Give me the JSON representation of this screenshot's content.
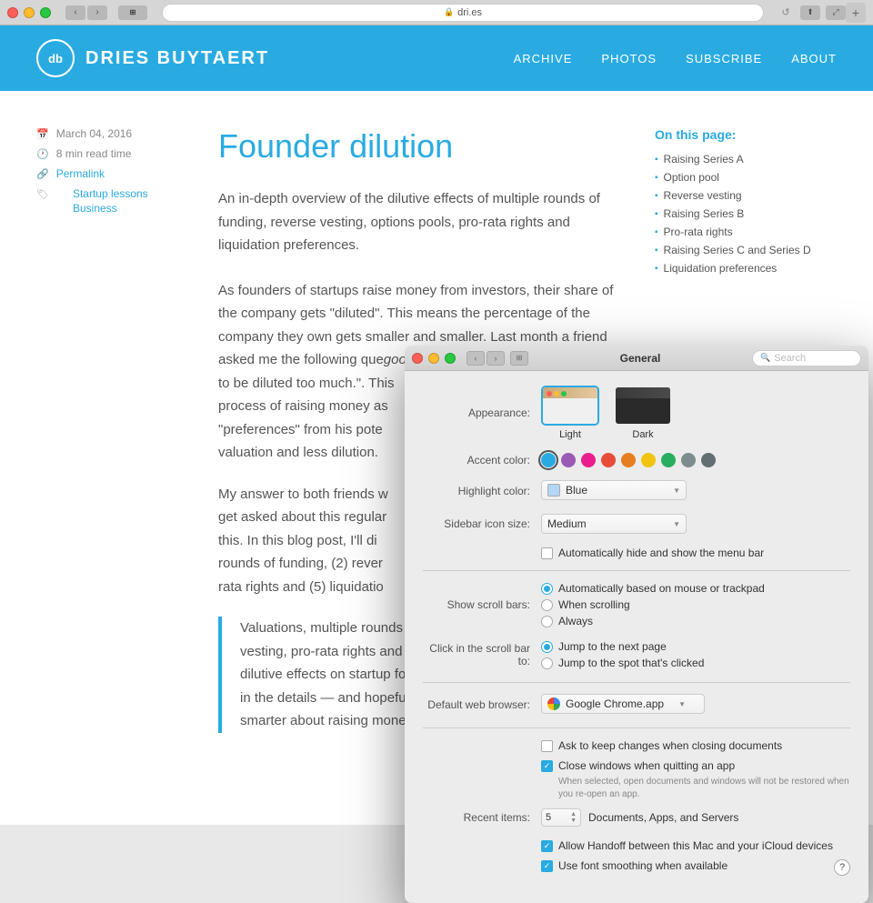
{
  "browser": {
    "url": "dri.es",
    "title": "General",
    "close_label": "×",
    "minimize_label": "−",
    "maximize_label": "+",
    "back_label": "‹",
    "forward_label": "›",
    "search_placeholder": "Search"
  },
  "site": {
    "logo_initials": "db",
    "site_name": "DRIES BUYTAERT",
    "nav": {
      "archive": "ARCHIVE",
      "photos": "PHOTOS",
      "subscribe": "SUBSCRIBE",
      "about": "ABOUT"
    }
  },
  "article": {
    "title": "Founder dilution",
    "meta": {
      "date": "March 04, 2016",
      "read_time": "8 min read time",
      "permalink": "Permalink",
      "tags": [
        "Startup lessons",
        "Business"
      ]
    },
    "intro": "An in-depth overview of the dilutive effects of multiple rounds of funding, reverse vesting, options pools, pro-rata rights and liquidation preferences.",
    "body1": "As founders of startups raise money from investors, their share of the company gets \"diluted\". This means the percentage of the company they own gets smaller and smaller. Last month a friend asked me the following que",
    "body1_italic": "good equity position as a start",
    "body1_cont": "to be diluted too much.\". This",
    "body1_cont2": "process of raising money as",
    "body1_cont3": "\"preferences\" from his pote",
    "body1_cont4": "valuation and less dilution.",
    "body2": "My answer to both friends w",
    "body2_cont": "get asked about this regular",
    "body2_cont2": "this. In this blog post, I'll di",
    "body2_cont3": "rounds of funding, (2) rever",
    "body2_cont4": "rata rights and (5) liquidatio",
    "blockquote": "Valuations, multiple rounds o",
    "blockquote2": "vesting, pro-rata rights and li",
    "blockquote3": "dilutive effects on startup fo",
    "blockquote4": "in the details — and hopeful",
    "blockquote5": "smarter about raising money"
  },
  "page_sidebar": {
    "title": "On this page:",
    "items": [
      "Raising Series A",
      "Option pool",
      "Reverse vesting",
      "Raising Series B",
      "Pro-rata rights",
      "Raising Series C and Series D",
      "Liquidation preferences"
    ]
  },
  "sys_prefs": {
    "title": "General",
    "search_placeholder": "Search",
    "appearance": {
      "label": "Appearance:",
      "options": [
        {
          "id": "light",
          "label": "Light",
          "selected": true
        },
        {
          "id": "dark",
          "label": "Dark",
          "selected": false
        }
      ]
    },
    "accent_color": {
      "label": "Accent color:",
      "colors": [
        {
          "id": "blue",
          "hex": "#29abe2",
          "selected": true
        },
        {
          "id": "purple",
          "hex": "#9b59b6",
          "selected": false
        },
        {
          "id": "pink",
          "hex": "#e91e8c",
          "selected": false
        },
        {
          "id": "red",
          "hex": "#e74c3c",
          "selected": false
        },
        {
          "id": "orange",
          "hex": "#e67e22",
          "selected": false
        },
        {
          "id": "yellow",
          "hex": "#f1c40f",
          "selected": false
        },
        {
          "id": "green",
          "hex": "#27ae60",
          "selected": false
        },
        {
          "id": "gray",
          "hex": "#7f8c8d",
          "selected": false
        },
        {
          "id": "graphite",
          "hex": "#636e72",
          "selected": false
        }
      ]
    },
    "highlight_color": {
      "label": "Highlight color:",
      "value": "Blue"
    },
    "sidebar_icon_size": {
      "label": "Sidebar icon size:",
      "value": "Medium"
    },
    "auto_hide_menu": {
      "label": "Automatically hide and show the menu bar",
      "checked": false
    },
    "show_scroll_bars": {
      "label": "Show scroll bars:",
      "options": [
        {
          "id": "auto",
          "label": "Automatically based on mouse or trackpad",
          "selected": true
        },
        {
          "id": "scrolling",
          "label": "When scrolling",
          "selected": false
        },
        {
          "id": "always",
          "label": "Always",
          "selected": false
        }
      ]
    },
    "click_scroll_bar": {
      "label": "Click in the scroll bar to:",
      "options": [
        {
          "id": "next_page",
          "label": "Jump to the next page",
          "selected": true
        },
        {
          "id": "clicked_spot",
          "label": "Jump to the spot that's clicked",
          "selected": false
        }
      ]
    },
    "default_browser": {
      "label": "Default web browser:",
      "value": "Google Chrome.app"
    },
    "ask_keep_changes": {
      "label": "Ask to keep changes when closing documents",
      "checked": false
    },
    "close_windows": {
      "label": "Close windows when quitting an app",
      "checked": true,
      "note": "When selected, open documents and windows will not be restored when you re-open an app."
    },
    "recent_items": {
      "label": "Recent items:",
      "value": "5",
      "suffix": "Documents, Apps, and Servers"
    },
    "handoff": {
      "label": "Allow Handoff between this Mac and your iCloud devices",
      "checked": true
    },
    "font_smoothing": {
      "label": "Use font smoothing when available",
      "checked": true
    }
  }
}
